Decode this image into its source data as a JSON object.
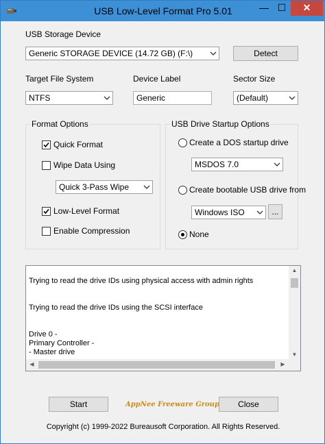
{
  "window": {
    "title": "USB Low-Level Format Pro 5.01",
    "minimize": "—",
    "maximize": "☐",
    "close": "✕"
  },
  "device": {
    "label": "USB Storage Device",
    "selected": "Generic STORAGE DEVICE (14.72 GB) (F:\\)",
    "detect_button": "Detect"
  },
  "filesystem": {
    "label": "Target File System",
    "selected": "NTFS"
  },
  "device_label": {
    "label": "Device Label",
    "value": "Generic"
  },
  "sector_size": {
    "label": "Sector Size",
    "selected": "(Default)"
  },
  "format_options": {
    "title": "Format Options",
    "quick_format": {
      "label": "Quick Format",
      "checked": true
    },
    "wipe_data": {
      "label": "Wipe Data Using",
      "checked": false
    },
    "wipe_method": "Quick 3-Pass Wipe",
    "low_level": {
      "label": "Low-Level Format",
      "checked": true
    },
    "compression": {
      "label": "Enable Compression",
      "checked": false
    }
  },
  "startup_options": {
    "title": "USB Drive Startup Options",
    "dos_option": {
      "label": "Create a DOS startup drive",
      "selected": false
    },
    "dos_version": "MSDOS 7.0",
    "bootable_option": {
      "label": "Create bootable USB drive from",
      "selected": false
    },
    "bootable_source": "Windows ISO",
    "browse_button": "...",
    "none_option": {
      "label": "None",
      "selected": true
    }
  },
  "log": {
    "lines": [
      "Trying to read the drive IDs using physical access with admin rights",
      "Trying to read the drive IDs using the SCSI interface",
      "Drive 0 -",
      "Primary Controller -",
      " - Master drive"
    ]
  },
  "footer": {
    "start_button": "Start",
    "close_button": "Close",
    "logo_text": "AppNee Freeware Group.",
    "copyright": "Copyright (c) 1999-2022 Bureausoft Corporation. All Rights Reserved."
  },
  "colors": {
    "titlebar": "#3d8fd6",
    "close_button": "#c7463d",
    "logo": "#c98a1a"
  }
}
